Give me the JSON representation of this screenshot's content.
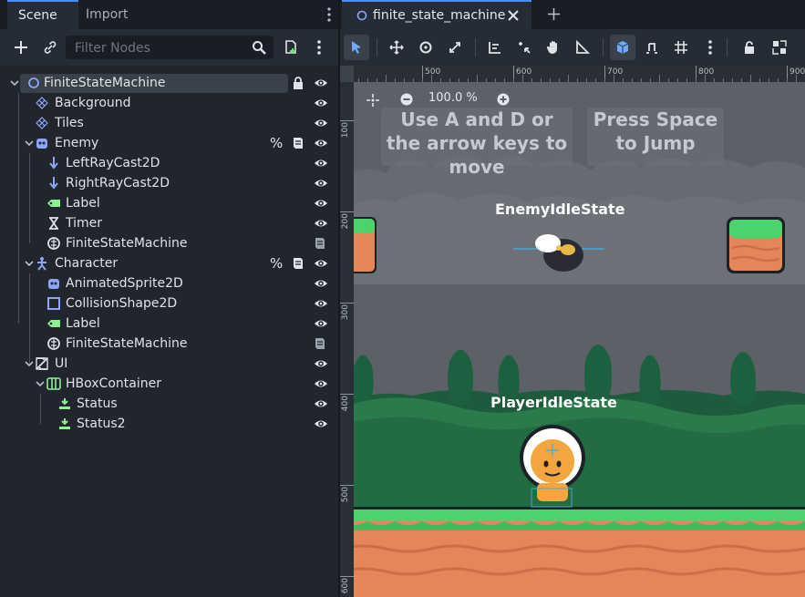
{
  "left_tabs": [
    {
      "label": "Scene"
    },
    {
      "label": "Import"
    }
  ],
  "filter": {
    "placeholder": "Filter Nodes"
  },
  "tree": [
    {
      "label": "FiniteStateMachine",
      "icon": "node2d-circle-icon",
      "depth": 0,
      "expanded": true,
      "selected": true,
      "lock": true,
      "eye": true
    },
    {
      "label": "Background",
      "icon": "parallax-icon",
      "depth": 1,
      "eye": true
    },
    {
      "label": "Tiles",
      "icon": "tilemap-icon",
      "depth": 1,
      "eye": true
    },
    {
      "label": "Enemy",
      "icon": "character-body-icon",
      "depth": 1,
      "expanded": true,
      "pct": true,
      "script": true,
      "eye": true
    },
    {
      "label": "LeftRayCast2D",
      "icon": "raycast-icon",
      "depth": 2,
      "eye": true
    },
    {
      "label": "RightRayCast2D",
      "icon": "raycast-icon",
      "depth": 2,
      "eye": true
    },
    {
      "label": "Label",
      "icon": "label-icon",
      "depth": 2,
      "eye": true
    },
    {
      "label": "Timer",
      "icon": "timer-icon",
      "depth": 2,
      "eye": true
    },
    {
      "label": "FiniteStateMachine",
      "icon": "brain-icon",
      "depth": 2,
      "script_only": true
    },
    {
      "label": "Character",
      "icon": "character-icon",
      "depth": 1,
      "expanded": true,
      "pct": true,
      "script": true,
      "eye": true
    },
    {
      "label": "AnimatedSprite2D",
      "icon": "animated-sprite-icon",
      "depth": 2,
      "eye": true
    },
    {
      "label": "CollisionShape2D",
      "icon": "collision-shape-icon",
      "depth": 2,
      "eye": true
    },
    {
      "label": "Label",
      "icon": "label-icon",
      "depth": 2,
      "eye": true
    },
    {
      "label": "FiniteStateMachine",
      "icon": "brain-icon",
      "depth": 2,
      "script_only": true
    },
    {
      "label": "UI",
      "icon": "canvas-layer-icon",
      "depth": 1,
      "expanded": true,
      "eye": true
    },
    {
      "label": "HBoxContainer",
      "icon": "hbox-icon",
      "depth": 2,
      "expanded": true,
      "eye": true
    },
    {
      "label": "Status",
      "icon": "control-icon",
      "depth": 3,
      "eye": true
    },
    {
      "label": "Status2",
      "icon": "control-icon",
      "depth": 3,
      "eye": true
    }
  ],
  "scene_tab": {
    "label": "finite_state_machine"
  },
  "zoom": {
    "label": "100.0 %"
  },
  "ruler_top": [
    "500",
    "600",
    "700",
    "800",
    "900"
  ],
  "ruler_left": [
    "100",
    "200",
    "300",
    "400",
    "500",
    "600"
  ],
  "hints": [
    "Use A and D or the arrow keys to move",
    "Press Space to Jump"
  ],
  "state_labels": {
    "enemy": "EnemyIdleState",
    "player": "PlayerIdleState"
  },
  "colors": {
    "accent": "#4a8bf5",
    "node2d": "#8da5f3",
    "control": "#8eef97",
    "selection": "#3b414a"
  }
}
